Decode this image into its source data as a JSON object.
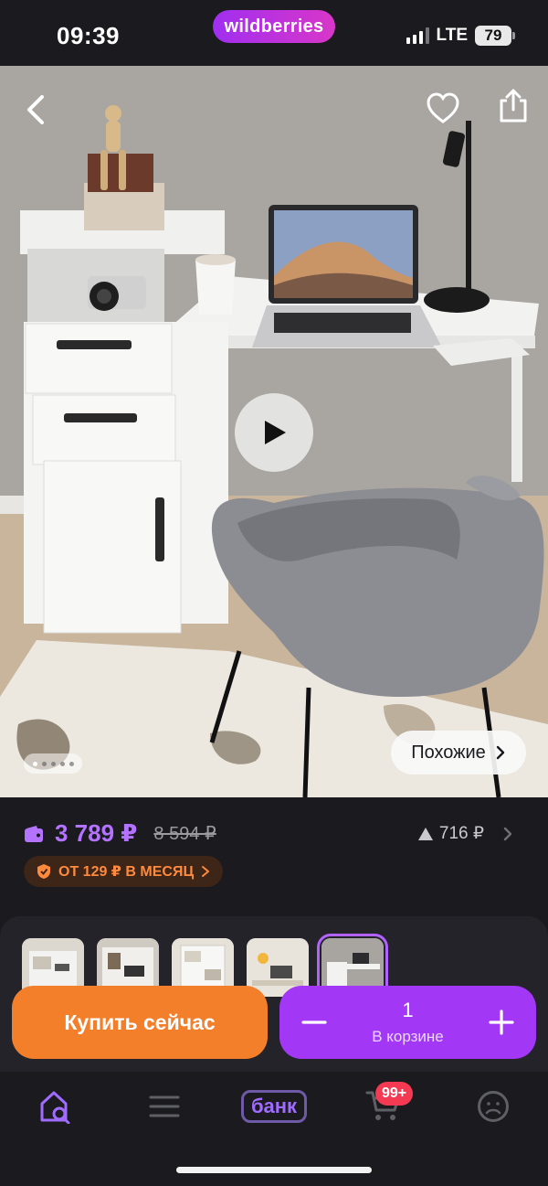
{
  "status": {
    "time": "09:39",
    "brand": "wildberries",
    "network": "LTE",
    "battery": "79"
  },
  "product": {
    "gallery": {
      "slide_count": 5,
      "active_slide": 1,
      "similar_label": "Похожие"
    },
    "price": {
      "current": "3 789 ₽",
      "old": "8 594 ₽",
      "rating_value": "716 ₽",
      "installment": "ОТ 129 ₽ В МЕСЯЦ"
    },
    "thumbnails": [
      {
        "name": "thumb-1"
      },
      {
        "name": "thumb-2"
      },
      {
        "name": "thumb-3"
      },
      {
        "name": "thumb-4"
      },
      {
        "name": "thumb-5",
        "active": true
      }
    ]
  },
  "actions": {
    "buy_now": "Купить сейчас",
    "quantity": "1",
    "in_cart": "В корзине"
  },
  "tabbar": {
    "bank_label": "банк",
    "cart_badge": "99+",
    "icons": [
      "home-search-icon",
      "catalog-menu-icon",
      "bank-icon",
      "cart-icon",
      "profile-icon"
    ]
  },
  "colors": {
    "accent_purple": "#a238f5",
    "price_purple": "#b473ff",
    "buy_orange": "#f37f2b",
    "installment_bg": "#3d2517",
    "badge_red": "#f43a52"
  }
}
